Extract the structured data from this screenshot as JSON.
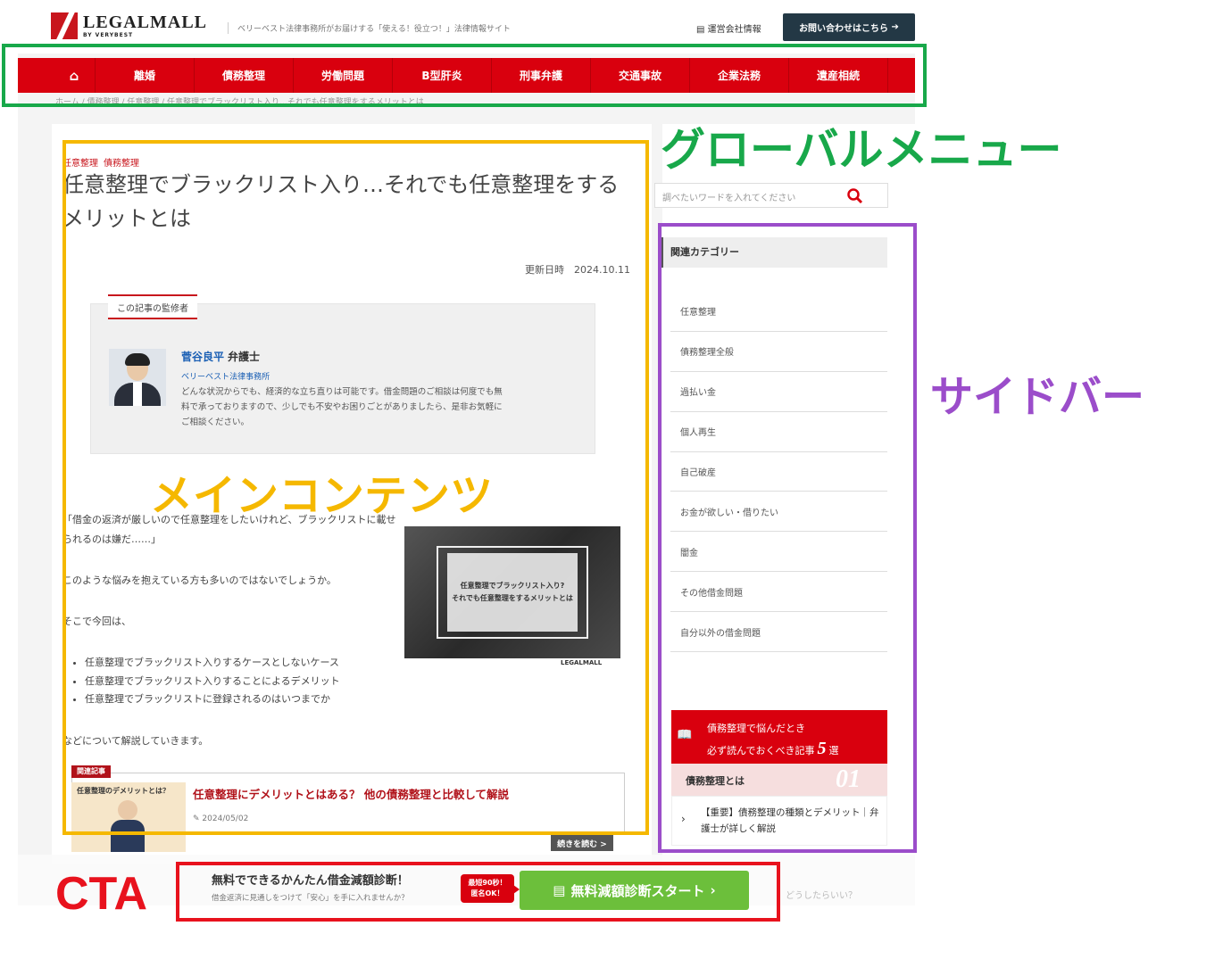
{
  "header": {
    "logo_main": "LEGALMALL",
    "logo_sub": "BY VERYBEST",
    "tagline": "ベリーベスト法律事務所がお届けする「使える！役立つ！」法律情報サイト",
    "company_link": "運営会社情報",
    "contact_button": "お問い合わせはこちら"
  },
  "nav": {
    "items": [
      "離婚",
      "債務整理",
      "労働問題",
      "B型肝炎",
      "刑事弁護",
      "交通事故",
      "企業法務",
      "遺産相続"
    ]
  },
  "breadcrumb": "ホーム / 債務整理 / 任意整理 / 任意整理でブラックリスト入り…それでも任意整理をするメリットとは",
  "article": {
    "categories": [
      "任意整理",
      "債務整理"
    ],
    "title": "任意整理でブラックリスト入り…それでも任意整理をするメリットとは",
    "updated": "更新日時　2024.10.11",
    "supervisor": {
      "label": "この記事の監修者",
      "name": "菅谷良平",
      "role": "弁護士",
      "office": "ベリーベスト法律事務所",
      "desc": "どんな状況からでも、経済的な立ち直りは可能です。借金問題のご相談は何度でも無料で承っておりますので、少しでも不安やお困りごとがありましたら、是非お気軽にご相談ください。"
    },
    "intro_quote": "「借金の返済が厳しいので任意整理をしたいけれど、ブラックリストに載せられるのは嫌だ……」",
    "p1": "このような悩みを抱えている方も多いのではないでしょうか。",
    "p2": "そこで今回は、",
    "bullets": [
      "任意整理でブラックリスト入りするケースとしないケース",
      "任意整理でブラックリスト入りすることによるデメリット",
      "任意整理でブラックリストに登録されるのはいつまでか"
    ],
    "p3": "などについて解説していきます。",
    "thumbnail_text": "任意整理でブラックリスト入り?\nそれでも任意整理をするメリットとは",
    "thumbnail_logo": "LEGALMALL",
    "related": {
      "tag": "関連記事",
      "image_title": "任意整理のデメリットとは？",
      "title": "任意整理にデメリットとはある？ 他の債務整理と比較して解説",
      "date": "2024/05/02",
      "read_more": "続きを読む >"
    }
  },
  "sidebar": {
    "search_placeholder": "調べたいワードを入れてください",
    "category_heading": "関連カテゴリー",
    "categories": [
      "任意整理",
      "債務整理全般",
      "過払い金",
      "個人再生",
      "自己破産",
      "お金が欲しい・借りたい",
      "闇金",
      "その他借金問題",
      "自分以外の借金問題"
    ],
    "reco_line1": "債務整理で悩んだとき",
    "reco_line2a": "必ず読んでおくべき記事",
    "reco_num": "5",
    "reco_line2b": "選",
    "reco_section": "債務整理とは",
    "reco_section_num": "01",
    "reco_item": "【重要】債務整理の種類とデメリット｜弁護士が詳しく解説"
  },
  "cta": {
    "title": "無料でできるかんたん借金減額診断！",
    "sub": "借金返済に見通しをつけて「安心」を手に入れませんか？",
    "badge": "最短90秒！\n匿名OK！",
    "button": "無料減額診断スタート",
    "ghost_text": "どうしたらいい？"
  },
  "annotations": {
    "global_menu": "グローバルメニュー",
    "main_contents": "メインコンテンツ",
    "sidebar": "サイドバー",
    "cta": "CTA"
  },
  "colors": {
    "brand_red": "#d9000e",
    "annot_green": "#18a84a",
    "annot_yellow": "#f5b800",
    "annot_purple": "#9b4dca",
    "annot_red": "#e8121d",
    "cta_green": "#6cbf3b"
  }
}
